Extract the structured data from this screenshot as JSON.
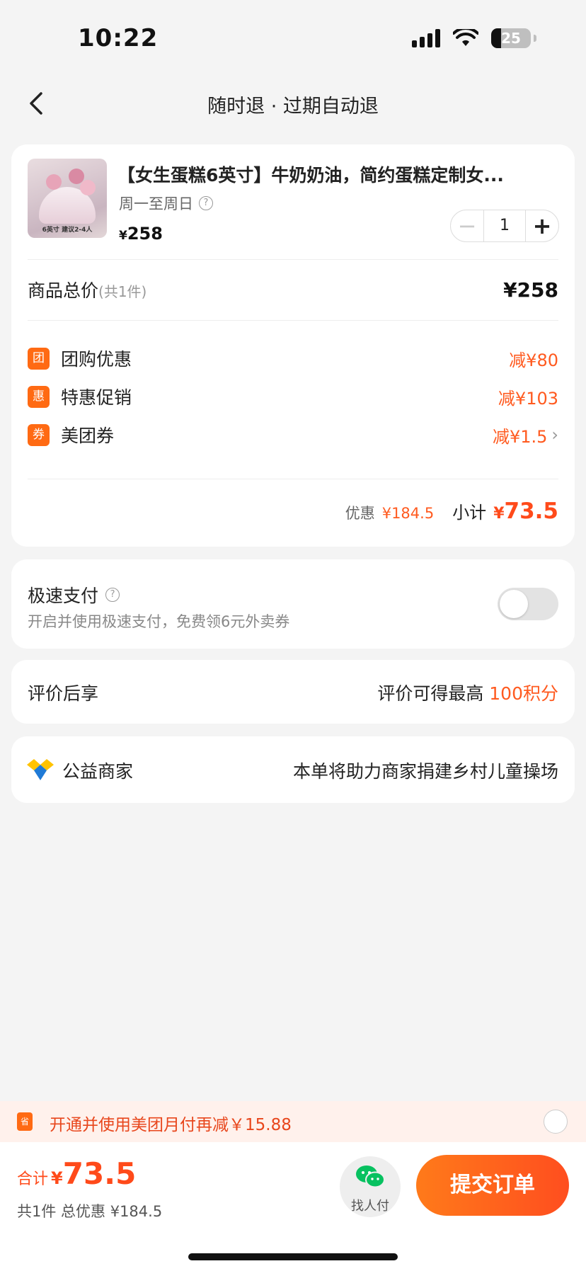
{
  "status_bar": {
    "time": "10:22",
    "battery": "25"
  },
  "nav": {
    "title": "随时退 · 过期自动退"
  },
  "product": {
    "title": "【女生蛋糕6英寸】牛奶奶油，简约蛋糕定制女...",
    "subtitle": "周一至周日",
    "image_caption": "6英寸 建议2-4人",
    "price_symbol": "¥",
    "price": "258",
    "quantity": "1"
  },
  "totals": {
    "goods_total_label": "商品总价",
    "goods_count": "(共1件)",
    "goods_total_value": "¥258"
  },
  "discounts": [
    {
      "badge": "团",
      "name": "团购优惠",
      "value": "减¥80"
    },
    {
      "badge": "惠",
      "name": "特惠促销",
      "value": "减¥103"
    },
    {
      "badge": "券",
      "name": "美团券",
      "value": "减¥1.5"
    }
  ],
  "subtotal": {
    "discount_label": "优惠",
    "discount_value": "¥184.5",
    "label": "小计",
    "symbol": "¥",
    "value": "73.5"
  },
  "speed_pay": {
    "title": "极速支付",
    "subtitle": "开启并使用极速支付，免费领6元外卖券"
  },
  "review": {
    "label": "评价后享",
    "prefix": "评价可得最高",
    "points": "100积分"
  },
  "charity": {
    "label": "公益商家",
    "text": "本单将助力商家捐建乡村儿童操场"
  },
  "promo": {
    "icon_text": "省",
    "text": "开通并使用美团月付再减￥15.88"
  },
  "bottom": {
    "total_label": "合计",
    "total_symbol": "¥",
    "total_value": "73.5",
    "summary": "共1件  总优惠 ¥184.5",
    "friend_pay_label": "找人付",
    "submit_label": "提交订单"
  },
  "colors": {
    "accent": "#ff5a1f",
    "badge": "#ff6a13",
    "wechat": "#07c160"
  }
}
